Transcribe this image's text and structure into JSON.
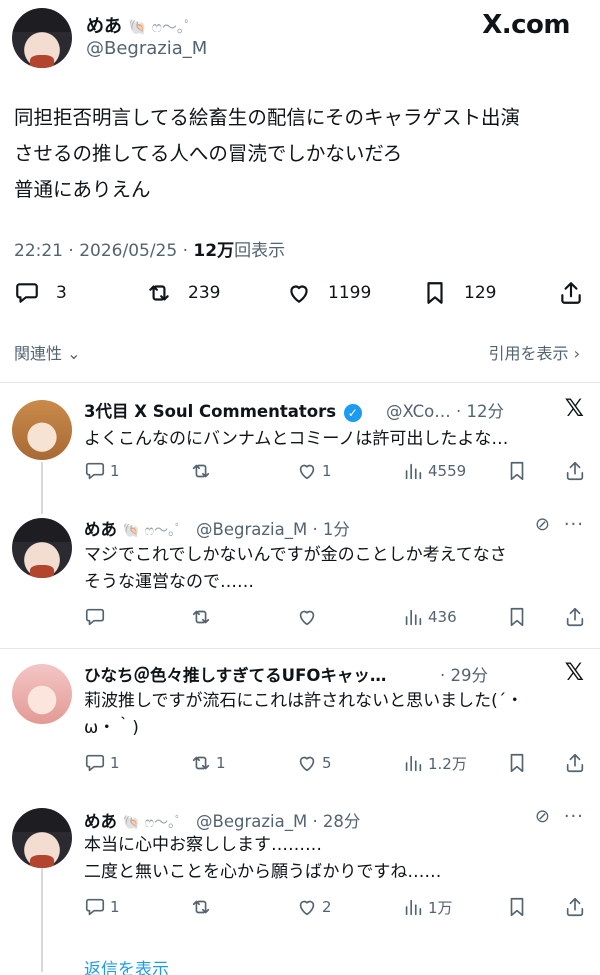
{
  "main": {
    "name": "めあ",
    "name_deco": "🐚 ෆ︎～｡ﾟ",
    "handle": "@Begrazia_M",
    "brand": "X.com",
    "text": "同担拒否明言してる絵畜生の配信にそのキャラゲスト出演\nさせるの推してる人への冒涜でしかないだろ\n普通にありえん",
    "time": "22:21 · 2026/05/25 · ",
    "views_num": "12万",
    "views_label": "回表示",
    "stats": {
      "replies": "3",
      "reposts": "239",
      "likes": "1199",
      "bookmarks": "129"
    },
    "sort_label": "関連性",
    "quotes_label": "引用を表示"
  },
  "replies": [
    {
      "name": "3代目 X Soul Commentators",
      "handle": "@XCo…",
      "time": "· 12分",
      "text": "よくこんなのにバンナムとコミーノは許可出したよな…",
      "actions": {
        "replies": "1",
        "reposts": "",
        "likes": "1",
        "views": "4559"
      }
    },
    {
      "name": "めあ",
      "name_deco": "🐚 ෆ︎～｡ﾟ",
      "handle": "@Begrazia_M",
      "time": "· 1分",
      "text": "マジでこれでしかないんですが金のことしか考えてなさ\nそうな運営なので……",
      "actions": {
        "replies": "",
        "reposts": "",
        "likes": "",
        "views": "436"
      }
    },
    {
      "name": "ひなち＠色々推しすぎてるUFOキャッ…",
      "handle": "",
      "time": "· 29分",
      "text": "莉波推しですが流石にこれは許されないと思いました(´・\nω・｀)",
      "actions": {
        "replies": "1",
        "reposts": "1",
        "likes": "5",
        "views": "1.2万"
      }
    },
    {
      "name": "めあ",
      "name_deco": "🐚 ෆ︎～｡ﾟ",
      "handle": "@Begrazia_M",
      "time": "· 28分",
      "text": "本当に心中お察しします………\n二度と無いことを心から願うばかりですね……",
      "actions": {
        "replies": "1",
        "reposts": "",
        "likes": "2",
        "views": "1万"
      }
    }
  ],
  "show_replies": "返信を表示"
}
